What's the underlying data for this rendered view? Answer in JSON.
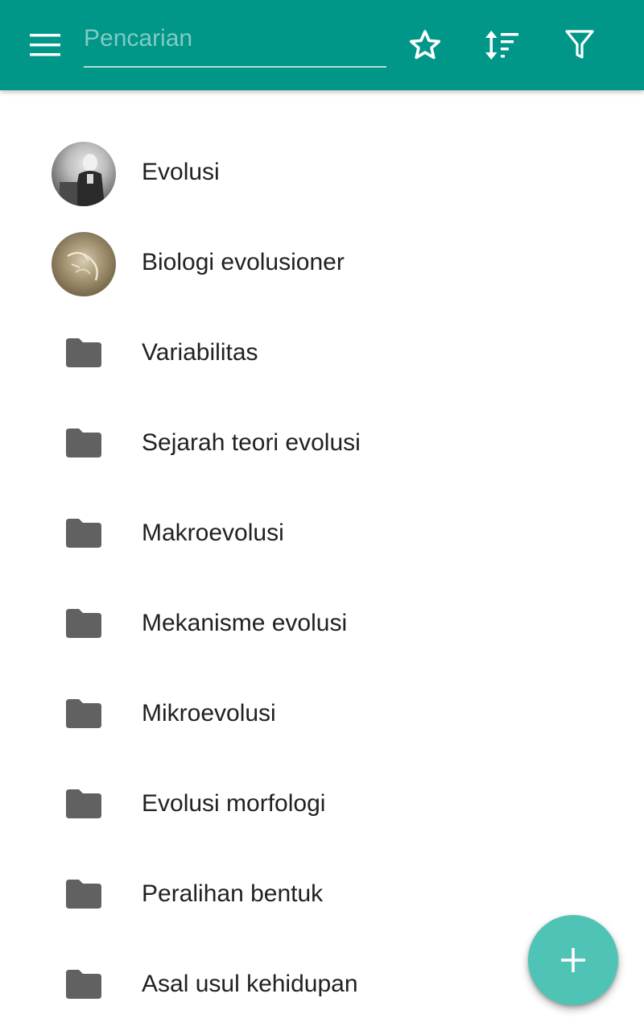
{
  "colors": {
    "appbar": "#009688",
    "accent_fab": "#4fc3b5",
    "text_primary": "#212121",
    "folder_icon": "#616161",
    "search_underline": "#b2dfdb",
    "placeholder": "#80cbc4"
  },
  "toolbar": {
    "menu_icon": "menu-icon",
    "search": {
      "placeholder": "Pencarian",
      "value": ""
    },
    "actions": [
      {
        "icon": "star-outline-icon"
      },
      {
        "icon": "sort-icon"
      },
      {
        "icon": "filter-icon"
      }
    ]
  },
  "list": {
    "items": [
      {
        "label": "Evolusi",
        "icon": "avatar-image"
      },
      {
        "label": "Biologi evolusioner",
        "icon": "avatar-image"
      },
      {
        "label": "Variabilitas",
        "icon": "folder-icon"
      },
      {
        "label": "Sejarah teori evolusi",
        "icon": "folder-icon"
      },
      {
        "label": "Makroevolusi",
        "icon": "folder-icon"
      },
      {
        "label": "Mekanisme evolusi",
        "icon": "folder-icon"
      },
      {
        "label": "Mikroevolusi",
        "icon": "folder-icon"
      },
      {
        "label": "Evolusi morfologi",
        "icon": "folder-icon"
      },
      {
        "label": "Peralihan bentuk",
        "icon": "folder-icon"
      },
      {
        "label": "Asal usul kehidupan",
        "icon": "folder-icon"
      }
    ]
  },
  "fab": {
    "icon": "plus-icon"
  }
}
